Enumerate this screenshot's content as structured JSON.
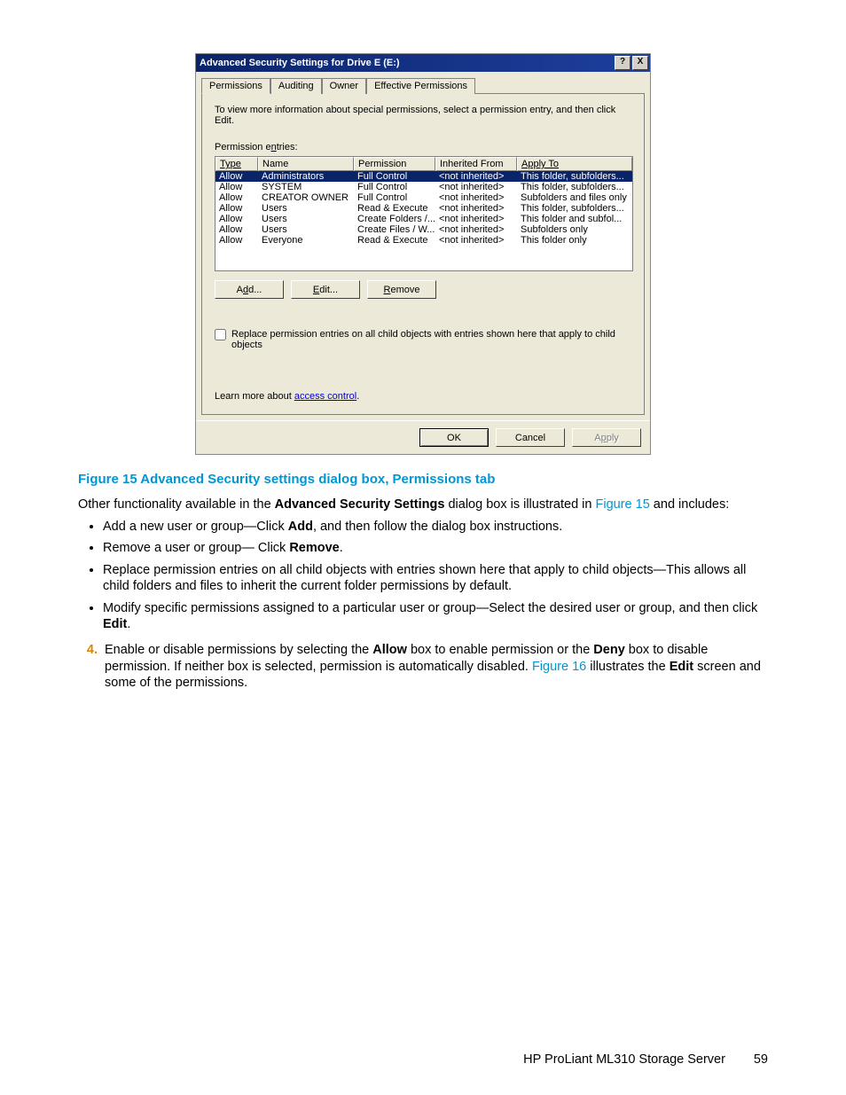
{
  "dialog": {
    "title": "Advanced Security Settings for Drive E (E:)",
    "help_btn": "?",
    "close_btn": "X",
    "tabs": [
      "Permissions",
      "Auditing",
      "Owner",
      "Effective Permissions"
    ],
    "info": "To view more information about special permissions, select a permission entry, and then click Edit.",
    "entries_label": "Permission entries:",
    "headers": {
      "type": "Type",
      "name": "Name",
      "perm": "Permission",
      "inh": "Inherited From",
      "apply": "Apply To"
    },
    "rows": [
      {
        "type": "Allow",
        "name": "Administrators",
        "perm": "Full Control",
        "inh": "<not inherited>",
        "apply": "This folder, subfolders..."
      },
      {
        "type": "Allow",
        "name": "SYSTEM",
        "perm": "Full Control",
        "inh": "<not inherited>",
        "apply": "This folder, subfolders..."
      },
      {
        "type": "Allow",
        "name": "CREATOR OWNER",
        "perm": "Full Control",
        "inh": "<not inherited>",
        "apply": "Subfolders and files only"
      },
      {
        "type": "Allow",
        "name": "Users",
        "perm": "Read & Execute",
        "inh": "<not inherited>",
        "apply": "This folder, subfolders..."
      },
      {
        "type": "Allow",
        "name": "Users",
        "perm": "Create Folders /...",
        "inh": "<not inherited>",
        "apply": "This folder and subfol..."
      },
      {
        "type": "Allow",
        "name": "Users",
        "perm": "Create Files / W...",
        "inh": "<not inherited>",
        "apply": "Subfolders only"
      },
      {
        "type": "Allow",
        "name": "Everyone",
        "perm": "Read & Execute",
        "inh": "<not inherited>",
        "apply": "This folder only"
      }
    ],
    "add_btn": "Add...",
    "edit_btn": "Edit...",
    "remove_btn": "Remove",
    "checkbox_label": "Replace permission entries on all child objects with entries shown here that apply to child objects",
    "learn_pre": "Learn more about ",
    "learn_link": "access control",
    "learn_post": ".",
    "ok_btn": "OK",
    "cancel_btn": "Cancel",
    "apply_btn": "Apply"
  },
  "doc": {
    "caption": "Figure 15 Advanced Security settings dialog box, Permissions tab",
    "p1a": "Other functionality available in the ",
    "p1b": "Advanced Security Settings",
    "p1c": " dialog box is illustrated in ",
    "p1link": "Figure 15",
    "p1d": " and includes:",
    "b1a": "Add a new user or group—Click ",
    "b1b": "Add",
    "b1c": ", and then follow the dialog box instructions.",
    "b2a": "Remove a user or group— Click ",
    "b2b": "Remove",
    "b2c": ".",
    "b3": "Replace permission entries on all child objects with entries shown here that apply to child objects—This allows all child folders and files to inherit the current folder permissions by default.",
    "b4a": "Modify specific permissions assigned to a particular user or group—Select the desired user or group, and then click ",
    "b4b": "Edit",
    "b4c": ".",
    "step_num": "4.",
    "s1a": "Enable or disable permissions by selecting the ",
    "s1b": "Allow",
    "s1c": " box to enable permission or the ",
    "s1d": "Deny",
    "s1e": " box to disable permission. If neither box is selected, permission is automatically disabled. ",
    "s1link": "Figure 16",
    "s1f": " illustrates the ",
    "s1g": "Edit",
    "s1h": " screen and some of the permissions.",
    "footer_text": "HP ProLiant ML310 Storage Server",
    "page_num": "59"
  }
}
